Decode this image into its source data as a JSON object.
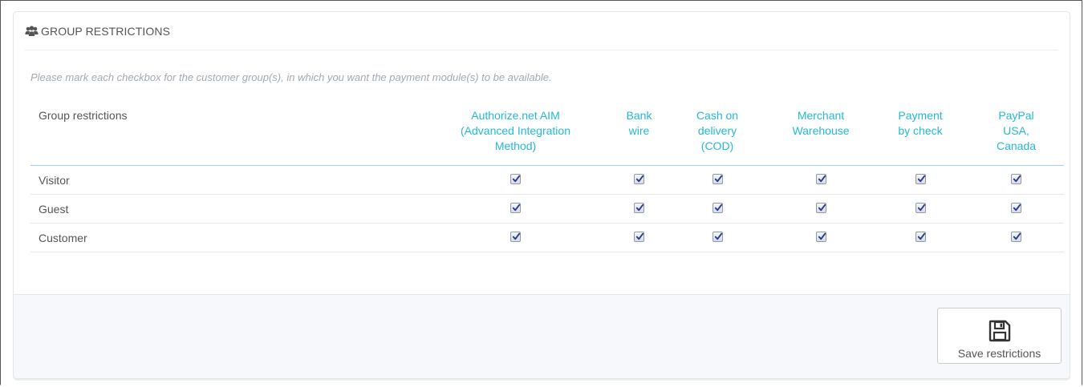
{
  "panel": {
    "title": "Group restrictions",
    "title_icon": "users-icon",
    "help_text": "Please mark each checkbox for the customer group(s), in which you want the payment module(s) to be available."
  },
  "table": {
    "first_header": "Group restrictions",
    "modules": [
      {
        "lines": [
          "Authorize.net AIM",
          "(Advanced Integration",
          "Method)"
        ]
      },
      {
        "lines": [
          "Bank",
          "wire"
        ]
      },
      {
        "lines": [
          "Cash on",
          "delivery",
          "(COD)"
        ]
      },
      {
        "lines": [
          "Merchant",
          "Warehouse"
        ]
      },
      {
        "lines": [
          "Payment",
          "by check"
        ]
      },
      {
        "lines": [
          "PayPal",
          "USA,",
          "Canada"
        ]
      }
    ],
    "rows": [
      {
        "label": "Visitor",
        "checked": [
          true,
          true,
          true,
          true,
          true,
          true
        ]
      },
      {
        "label": "Guest",
        "checked": [
          true,
          true,
          true,
          true,
          true,
          true
        ]
      },
      {
        "label": "Customer",
        "checked": [
          true,
          true,
          true,
          true,
          true,
          true
        ]
      }
    ]
  },
  "footer": {
    "save_label": "Save restrictions",
    "save_icon": "floppy-disk-icon"
  },
  "colors": {
    "accent": "#25b9d7",
    "text": "#555555",
    "muted": "#a0aab3"
  }
}
